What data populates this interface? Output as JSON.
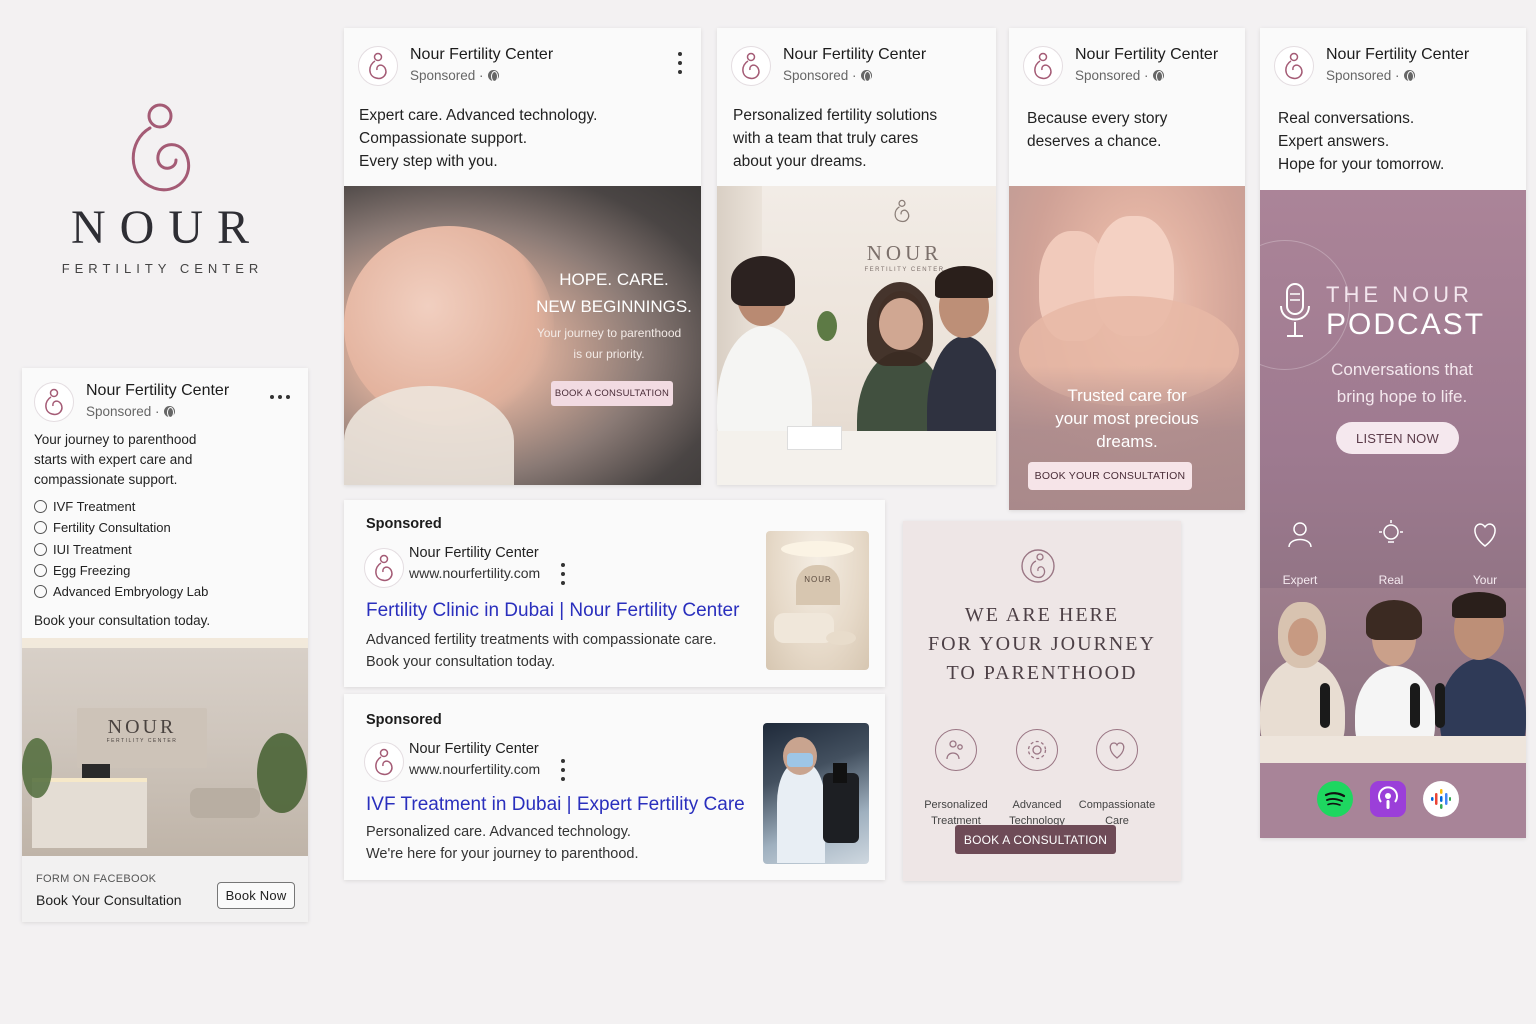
{
  "brand": {
    "name_word": "NOUR",
    "subtitle": "FERTILITY CENTER",
    "accent": "#a45b75",
    "dark": "#6e4b57"
  },
  "page_name": "Nour Fertility Center",
  "sponsored": "Sponsored ·",
  "lead_ad": {
    "caption": "Your journey to parenthood\nstarts with expert care and\ncompassionate support.",
    "services": [
      "IVF Treatment",
      "Fertility Consultation",
      "IUI Treatment",
      "Egg Freezing",
      "Advanced Embryology Lab"
    ],
    "cta_line": "Book your consultation today.",
    "lobby_sign": "NOUR",
    "lobby_sign_sub": "FERTILITY CENTER",
    "form_label": "FORM ON FACEBOOK",
    "form_title": "Book Your Consultation",
    "book_button": "Book Now"
  },
  "post1": {
    "caption": "Expert care. Advanced technology.\nCompassionate support.\nEvery step with you.",
    "headline1": "HOPE. CARE.",
    "headline2": "NEW BEGINNINGS.",
    "sub": "Your journey to parenthood\nis our priority.",
    "button": "BOOK A CONSULTATION"
  },
  "post2": {
    "caption": "Personalized fertility solutions\nwith a team that truly cares\nabout your dreams.",
    "wall_sign": "NOUR",
    "wall_sign_sub": "FERTILITY CENTER"
  },
  "post3": {
    "caption": "Because every story\ndeserves a chance.",
    "overlay": "Trusted care for\nyour most precious\ndreams.",
    "button": "BOOK YOUR CONSULTATION"
  },
  "podcast": {
    "caption": "Real conversations.\nExpert answers.\nHope for your tomorrow.",
    "title_small": "THE NOUR",
    "title_big": "PODCAST",
    "tagline": "Conversations that\nbring hope to life.",
    "button": "LISTEN NOW",
    "features": [
      "Expert\nDoctors",
      "Real\nAnswers",
      "Your\nJourney"
    ],
    "apps": [
      "spotify-icon",
      "apple-podcasts-icon",
      "google-podcasts-icon"
    ]
  },
  "search_ads": [
    {
      "label": "Sponsored",
      "name": "Nour Fertility Center",
      "url": "www.nourfertility.com",
      "title": "Fertility Clinic in Dubai | Nour Fertility Center",
      "desc": "Advanced fertility treatments with compassionate care.\nBook your consultation today.",
      "thumb_sign": "NOUR"
    },
    {
      "label": "Sponsored",
      "name": "Nour Fertility Center",
      "url": "www.nourfertility.com",
      "title": "IVF Treatment in Dubai | Expert Fertility Care",
      "desc": "Personalized care. Advanced technology.\nWe're here for your journey to parenthood."
    }
  ],
  "parenthood": {
    "headline": "WE ARE HERE\nFOR YOUR JOURNEY\nTO PARENTHOOD",
    "features": [
      "Personalized\nTreatment",
      "Advanced\nTechnology",
      "Compassionate\nCare"
    ],
    "button": "BOOK A CONSULTATION"
  }
}
